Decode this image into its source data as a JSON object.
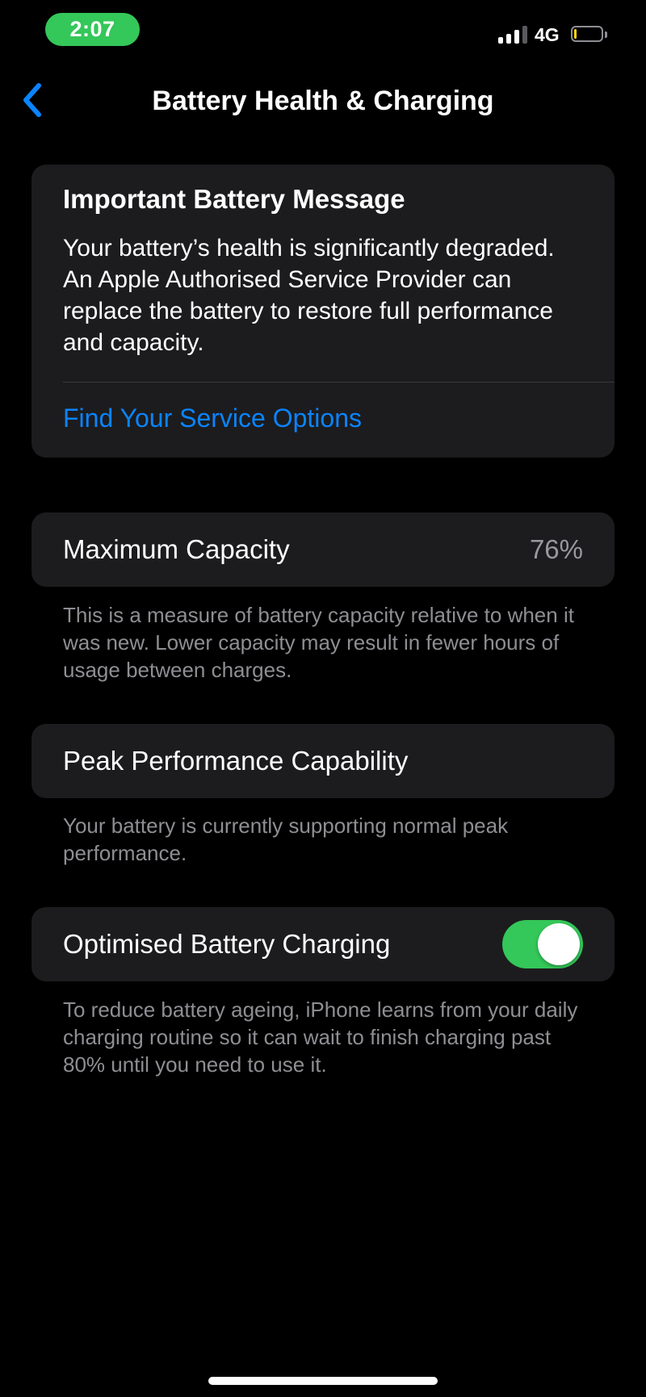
{
  "status_bar": {
    "time": "2:07",
    "network": "4G",
    "signal_bars_filled": 3,
    "signal_bars_total": 4,
    "battery_level_fraction": 0.1,
    "time_pill_color": "#34c759",
    "battery_color": "#ffd60a"
  },
  "nav": {
    "back_icon": "chevron-left-icon",
    "title": "Battery Health & Charging"
  },
  "message_card": {
    "title": "Important Battery Message",
    "body": "Your battery’s health is significantly degraded. An Apple Authorised Service Provider can replace the battery to restore full performance and capacity.",
    "link": "Find Your Service Options",
    "link_color": "#0a84ff"
  },
  "maximum_capacity": {
    "label": "Maximum Capacity",
    "value": "76%",
    "footnote": "This is a measure of battery capacity relative to when it was new. Lower capacity may result in fewer hours of usage between charges."
  },
  "peak_performance": {
    "label": "Peak Performance Capability",
    "footnote": "Your battery is currently supporting normal peak performance."
  },
  "optimised_charging": {
    "label": "Optimised Battery Charging",
    "enabled": true,
    "toggle_color": "#34c759",
    "footnote": "To reduce battery ageing, iPhone learns from your daily charging routine so it can wait to finish charging past 80% until you need to use it."
  }
}
